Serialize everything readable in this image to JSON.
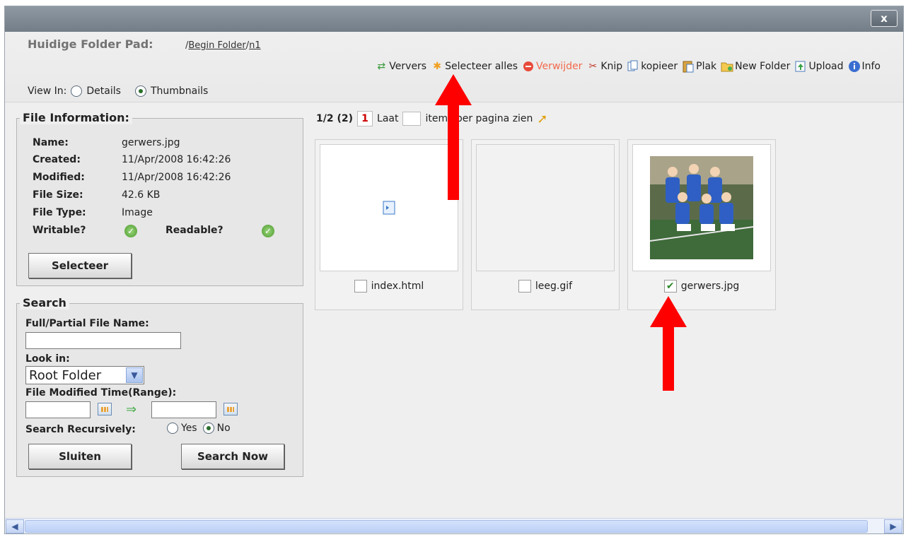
{
  "window": {
    "close_label": "x"
  },
  "header": {
    "path_label": "Huidige Folder Pad:",
    "path_prefix": "/",
    "path_root": "Begin Folder",
    "path_sep": "/",
    "path_current": "n1",
    "view_in_label": "View In:",
    "view_details": "Details",
    "view_thumbnails": "Thumbnails"
  },
  "toolbar": {
    "refresh": "Ververs",
    "select_all": "Selecteer alles",
    "delete": "Verwijder",
    "cut": "Knip",
    "copy": "kopieer",
    "paste": "Plak",
    "new_folder": "New Folder",
    "upload": "Upload",
    "info": "Info"
  },
  "file_info": {
    "title": "File Information:",
    "name_label": "Name:",
    "name_value": "gerwers.jpg",
    "created_label": "Created:",
    "created_value": "11/Apr/2008 16:42:26",
    "modified_label": "Modified:",
    "modified_value": "11/Apr/2008 16:42:26",
    "size_label": "File Size:",
    "size_value": "42.6 KB",
    "type_label": "File Type:",
    "type_value": "Image",
    "writable_label": "Writable?",
    "readable_label": "Readable?",
    "select_button": "Selecteer"
  },
  "search": {
    "title": "Search",
    "name_label": "Full/Partial File Name:",
    "name_value": "",
    "look_in_label": "Look in:",
    "look_in_value": "Root Folder",
    "modified_label": "File Modified Time(Range):",
    "recursive_label": "Search Recursively:",
    "yes": "Yes",
    "no": "No",
    "close_button": "Sluiten",
    "search_button": "Search Now"
  },
  "pager": {
    "summary": "1/2 (2)",
    "page": "1",
    "show_label": "Laat",
    "per_page_label": "items per pagina zien"
  },
  "files": [
    {
      "name": "index.html",
      "checked": false
    },
    {
      "name": "leeg.gif",
      "checked": false
    },
    {
      "name": "gerwers.jpg",
      "checked": true
    }
  ],
  "colors": {
    "delete_text": "#f26a4b",
    "annotation_arrow": "#ff0000"
  }
}
